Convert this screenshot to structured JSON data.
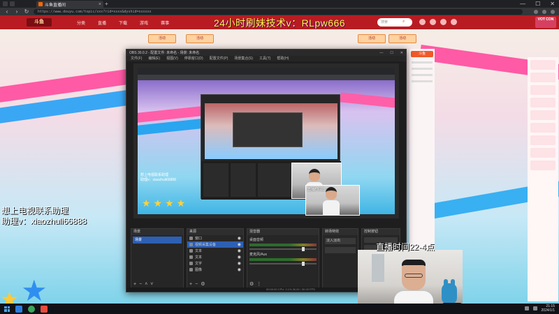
{
  "browser": {
    "tab_title": "斗鱼直播间",
    "url": "https://www.douyu.com/topic/xxx?rid=xxxx&dyshid=xxxxxx",
    "window_controls": [
      "—",
      "☐",
      "✕"
    ]
  },
  "site": {
    "logo": "斗鱼",
    "nav": [
      "分类",
      "直播",
      "下载",
      "游戏",
      "赛事"
    ],
    "search_placeholder": "搜索",
    "badge": "VOT CON",
    "ad_buttons": [
      "活动",
      "活动",
      "活动",
      "活动"
    ],
    "rightrail_items": 9,
    "sidepanel_logo": "斗鱼"
  },
  "overlays": {
    "title": "24小时刷妹技术v：RLpw666",
    "left_line1": "想上电视联系助理",
    "left_line2": "助理v：xiaozhuli66888",
    "time": "直播时间22-4点"
  },
  "obs": {
    "title": "OBS 30.0.2 - 配置文件: 未命名 - 场景: 未命名",
    "menu": [
      "文件(F)",
      "编辑(E)",
      "视图(V)",
      "停靠窗口(D)",
      "配置文件(P)",
      "场景集合(S)",
      "工具(T)",
      "帮助(H)"
    ],
    "preview_title": "24小时刷妹技术v：RLpw666",
    "preview_caption1": "想上电视联系助理",
    "preview_caption2": "助理v：xiaozhuli66888",
    "webcam_caption": "直播时间22-4点",
    "panels": {
      "scenes": "场景",
      "sources": "来源",
      "mixer": "混音器",
      "transitions": "转场特效",
      "controls": "控制按钮"
    },
    "scene_items": [
      "场景"
    ],
    "source_items": [
      "窗口",
      "视频采集设备",
      "文本",
      "文本",
      "文字",
      "图像"
    ],
    "mixer_tracks": [
      "桌面音频",
      "麦克风/Aux"
    ],
    "transition": "淡入淡出",
    "status": "00:00:00  CPU: 2.1%  30.00 / 30.00 FPS"
  },
  "taskbar": {
    "time": "21:15",
    "date": "2024/1/1"
  }
}
